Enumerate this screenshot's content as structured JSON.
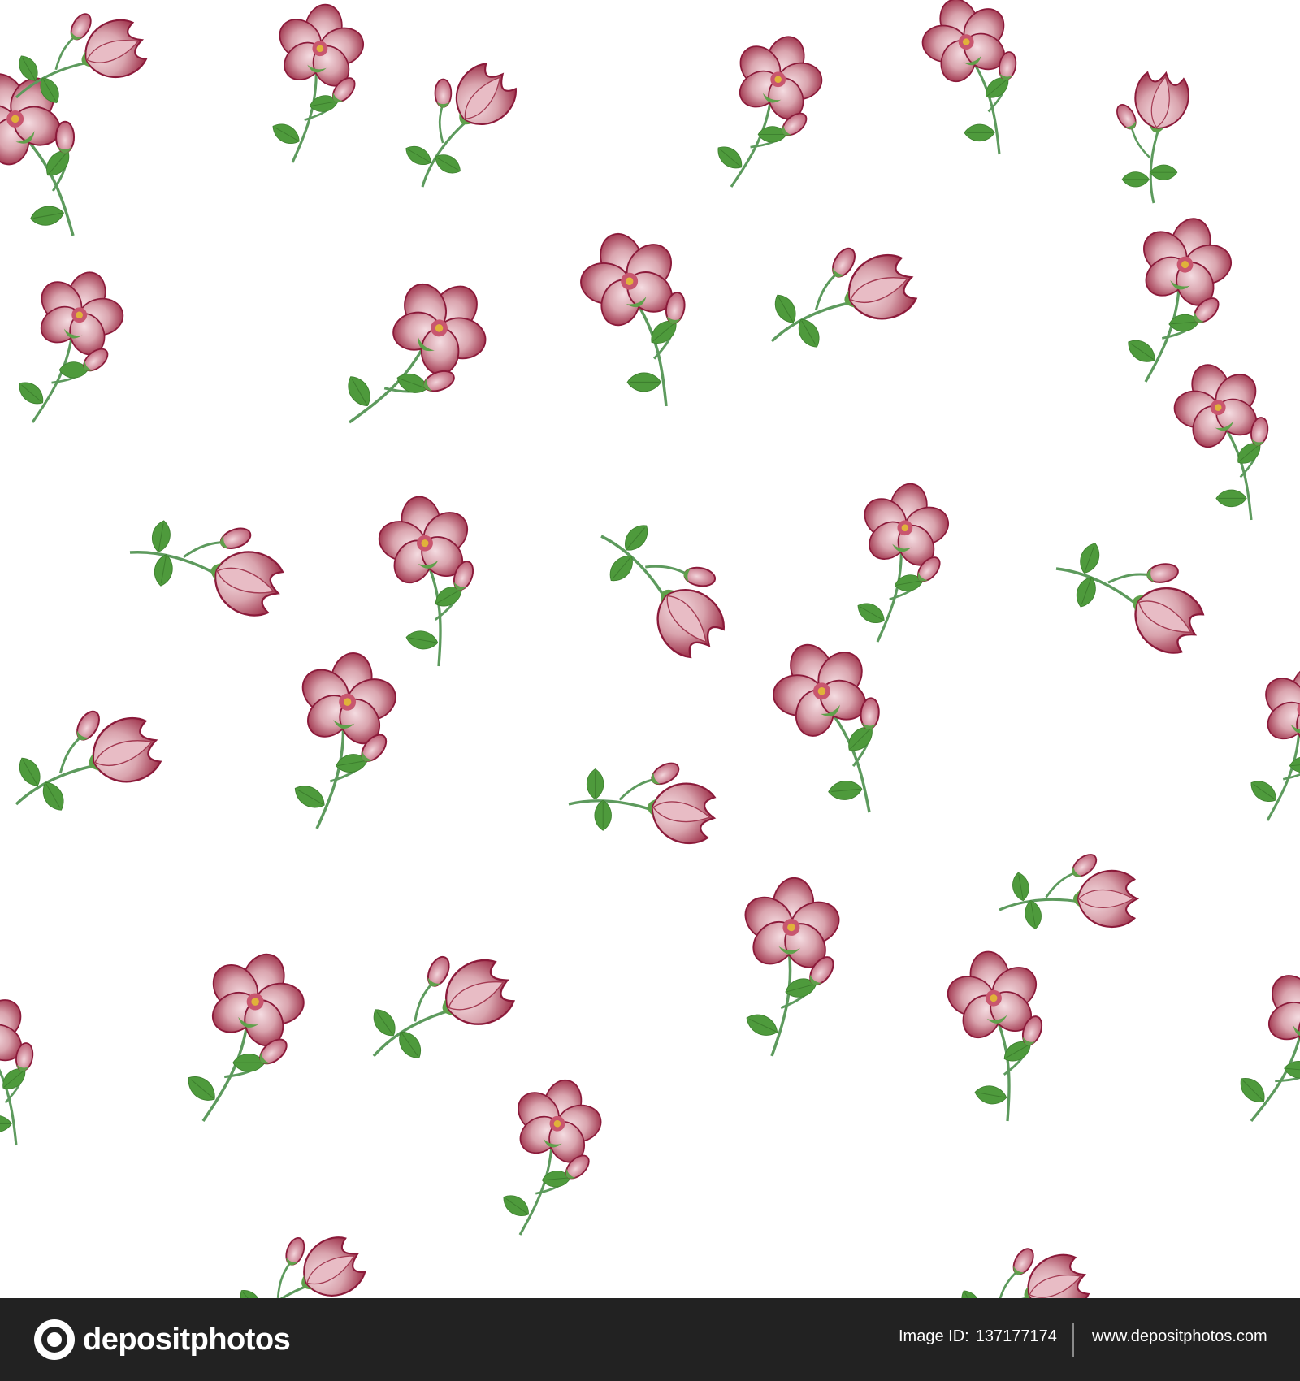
{
  "image": {
    "subject": "floral-pattern",
    "colors": {
      "background": "#ffffff",
      "petal": "#d9a3ad",
      "petal_dark": "#a33a52",
      "petal_edge": "#8b1a3a",
      "leaf": "#4e9a3c",
      "leaf_dark": "#3d7f2e",
      "stem": "#5d9a5d",
      "center": "#e0b23a"
    }
  },
  "footer": {
    "brand": "depositphotos",
    "image_id_label": "Image ID:",
    "image_id": "137177174",
    "site": "www.depositphotos.com"
  }
}
